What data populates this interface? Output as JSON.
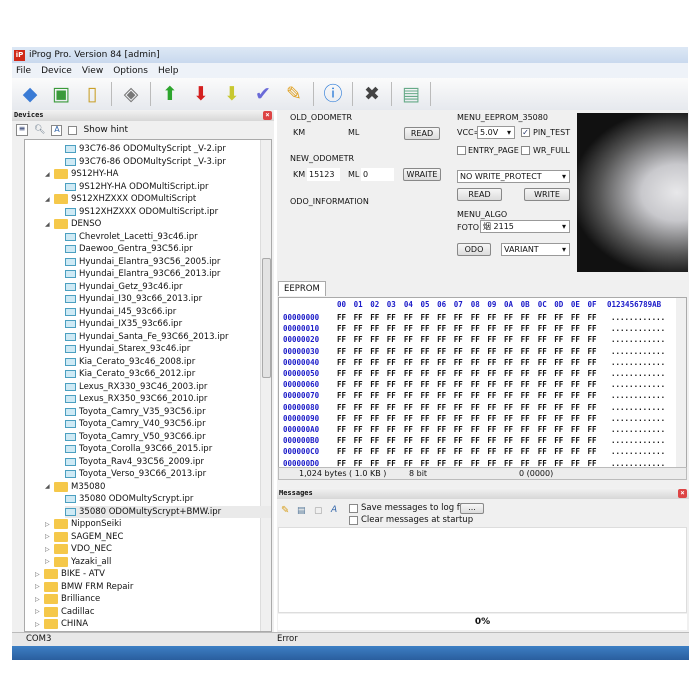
{
  "window": {
    "title": "iProg Pro. Version 84 [admin]",
    "icon_text": "iP"
  },
  "menu": [
    "File",
    "Device",
    "View",
    "Options",
    "Help"
  ],
  "toolbar": [
    "open-icon",
    "save-icon",
    "new-file-icon",
    "chip-icon",
    "arrow-up-icon",
    "arrow-down-icon",
    "arrow-down-yellow-icon",
    "check-icon",
    "broom-icon",
    "info-icon",
    "close-x-icon",
    "calculator-icon"
  ],
  "devices": {
    "title": "Devices",
    "show_hint": "Show hint",
    "tree": [
      {
        "l": 3,
        "t": "file",
        "label": "93C76-86  ODOMultyScript _V-2.ipr"
      },
      {
        "l": 3,
        "t": "file",
        "label": "93C76-86  ODOMultyScript _V-3.ipr"
      },
      {
        "l": 2,
        "t": "folder",
        "open": true,
        "label": "9S12HY-HA"
      },
      {
        "l": 3,
        "t": "file",
        "label": "9S12HY-HA ODOMultiScript.ipr"
      },
      {
        "l": 2,
        "t": "folder",
        "open": true,
        "label": "9S12XHZXXX ODOMultiScript"
      },
      {
        "l": 3,
        "t": "file",
        "label": "9S12XHZXXX ODOMultiScript.ipr"
      },
      {
        "l": 2,
        "t": "folder",
        "open": true,
        "label": "DENSO"
      },
      {
        "l": 3,
        "t": "file",
        "label": "Chevrolet_Lacetti_93c46.ipr"
      },
      {
        "l": 3,
        "t": "file",
        "label": "Daewoo_Gentra_93C56.ipr"
      },
      {
        "l": 3,
        "t": "file",
        "label": "Hyundai_Elantra_93C56_2005.ipr"
      },
      {
        "l": 3,
        "t": "file",
        "label": "Hyundai_Elantra_93C66_2013.ipr"
      },
      {
        "l": 3,
        "t": "file",
        "label": "Hyundai_Getz_93c46.ipr"
      },
      {
        "l": 3,
        "t": "file",
        "label": "Hyundai_I30_93c66_2013.ipr"
      },
      {
        "l": 3,
        "t": "file",
        "label": "Hyundai_I45_93c66.ipr"
      },
      {
        "l": 3,
        "t": "file",
        "label": "Hyundai_IX35_93c66.ipr"
      },
      {
        "l": 3,
        "t": "file",
        "label": "Hyundai_Santa_Fe_93C66_2013.ipr"
      },
      {
        "l": 3,
        "t": "file",
        "label": "Hyundai_Starex_93c46.ipr"
      },
      {
        "l": 3,
        "t": "file",
        "label": "Kia_Cerato_93c46_2008.ipr"
      },
      {
        "l": 3,
        "t": "file",
        "label": "Kia_Cerato_93c66_2012.ipr"
      },
      {
        "l": 3,
        "t": "file",
        "label": "Lexus_RX330_93C46_2003.ipr"
      },
      {
        "l": 3,
        "t": "file",
        "label": "Lexus_RX350_93C66_2010.ipr"
      },
      {
        "l": 3,
        "t": "file",
        "label": "Toyota_Camry_V35_93C56.ipr"
      },
      {
        "l": 3,
        "t": "file",
        "label": "Toyota_Camry_V40_93C56.ipr"
      },
      {
        "l": 3,
        "t": "file",
        "label": "Toyota_Camry_V50_93C66.ipr"
      },
      {
        "l": 3,
        "t": "file",
        "label": "Toyota_Corolla_93C66_2015.ipr"
      },
      {
        "l": 3,
        "t": "file",
        "label": "Toyota_Rav4_93C56_2009.ipr"
      },
      {
        "l": 3,
        "t": "file",
        "label": "Toyota_Verso_93C66_2013.ipr"
      },
      {
        "l": 2,
        "t": "folder",
        "open": true,
        "label": "M35080"
      },
      {
        "l": 3,
        "t": "file",
        "label": "35080 ODOMultyScrypt.ipr"
      },
      {
        "l": 3,
        "t": "file",
        "label": "35080 ODOMultyScrypt+BMW.ipr",
        "selected": true
      },
      {
        "l": 2,
        "t": "folder",
        "label": "NipponSeiki"
      },
      {
        "l": 2,
        "t": "folder",
        "label": "SAGEM_NEC"
      },
      {
        "l": 2,
        "t": "folder",
        "label": "VDO_NEC"
      },
      {
        "l": 2,
        "t": "folder",
        "label": "Yazaki_all"
      },
      {
        "l": 1,
        "t": "folder",
        "label": "BIKE - ATV"
      },
      {
        "l": 1,
        "t": "folder",
        "label": "BMW FRM Repair"
      },
      {
        "l": 1,
        "t": "folder",
        "label": "Brilliance"
      },
      {
        "l": 1,
        "t": "folder",
        "label": "Cadillac"
      },
      {
        "l": 1,
        "t": "folder",
        "label": "CHINA"
      }
    ]
  },
  "odo": {
    "old_title": "OLD_ODOMETR",
    "km": "KM",
    "ml": "ML",
    "read": "READ",
    "new_title": "NEW_ODOMETR",
    "new_km": "15123",
    "new_ml": "0",
    "write": "WRAITE",
    "info_title": "ODO_INFORMATION"
  },
  "eeprom_menu": {
    "title": "MENU_EEPROM_35080",
    "vcc_label": "VCC=",
    "vcc": "5.0V",
    "pin_test": "PIN_TEST",
    "pin_test_checked": true,
    "entry_page": "ENTRY_PAGE",
    "wr_full": "WR_FULL",
    "protect": "NO WRITE_PROTECT",
    "read": "READ",
    "write": "WRITE",
    "algo_title": "MENU_ALGO",
    "foto": "FOTO",
    "algo_value": "烟 2115",
    "odo": "ODO",
    "variant": "VARIANT"
  },
  "hex": {
    "tab": "EEPROM",
    "columns": [
      "00",
      "01",
      "02",
      "03",
      "04",
      "05",
      "06",
      "07",
      "08",
      "09",
      "0A",
      "0B",
      "0C",
      "0D",
      "0E",
      "0F"
    ],
    "ascii_header": "0123456789AB",
    "rows": [
      {
        "a": "00000000",
        "b": "FF FF FF FF FF FF FF FF FF FF FF FF FF FF FF FF",
        "s": "............"
      },
      {
        "a": "00000010",
        "b": "FF FF FF FF FF FF FF FF FF FF FF FF FF FF FF FF",
        "s": "............"
      },
      {
        "a": "00000020",
        "b": "FF FF FF FF FF FF FF FF FF FF FF FF FF FF FF FF",
        "s": "............"
      },
      {
        "a": "00000030",
        "b": "FF FF FF FF FF FF FF FF FF FF FF FF FF FF FF FF",
        "s": "............"
      },
      {
        "a": "00000040",
        "b": "FF FF FF FF FF FF FF FF FF FF FF FF FF FF FF FF",
        "s": "............"
      },
      {
        "a": "00000050",
        "b": "FF FF FF FF FF FF FF FF FF FF FF FF FF FF FF FF",
        "s": "............"
      },
      {
        "a": "00000060",
        "b": "FF FF FF FF FF FF FF FF FF FF FF FF FF FF FF FF",
        "s": "............"
      },
      {
        "a": "00000070",
        "b": "FF FF FF FF FF FF FF FF FF FF FF FF FF FF FF FF",
        "s": "............"
      },
      {
        "a": "00000080",
        "b": "FF FF FF FF FF FF FF FF FF FF FF FF FF FF FF FF",
        "s": "............"
      },
      {
        "a": "00000090",
        "b": "FF FF FF FF FF FF FF FF FF FF FF FF FF FF FF FF",
        "s": "............"
      },
      {
        "a": "000000A0",
        "b": "FF FF FF FF FF FF FF FF FF FF FF FF FF FF FF FF",
        "s": "............"
      },
      {
        "a": "000000B0",
        "b": "FF FF FF FF FF FF FF FF FF FF FF FF FF FF FF FF",
        "s": "............"
      },
      {
        "a": "000000C0",
        "b": "FF FF FF FF FF FF FF FF FF FF FF FF FF FF FF FF",
        "s": "............"
      },
      {
        "a": "000000D0",
        "b": "FF FF FF FF FF FF FF FF FF FF FF FF FF FF FF FF",
        "s": "............"
      }
    ],
    "status_size": "1,024 bytes ( 1.0 KB )",
    "status_bits": "8 bit",
    "status_pos": "0 (0000)"
  },
  "messages": {
    "title": "Messages",
    "save_log": "Save messages to log fi",
    "browse": "...",
    "clear_startup": "Clear messages at startup",
    "progress": "0%"
  },
  "status": {
    "port": "COM3",
    "state": "Error"
  }
}
